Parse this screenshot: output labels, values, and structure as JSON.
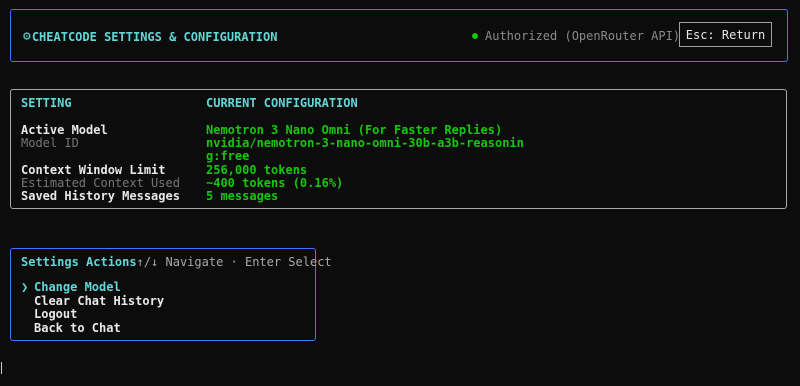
{
  "header": {
    "gear_icon": "⚙",
    "title": "CHEATCODE SETTINGS & CONFIGURATION",
    "status_text": "Authorized (OpenRouter API)",
    "status_color": "#16c60c",
    "esc_label": "Esc: Return"
  },
  "config": {
    "col_setting": "SETTING",
    "col_current": "CURRENT CONFIGURATION",
    "rows": [
      {
        "key": "Active Model",
        "value": "Nemotron 3 Nano Omni (For Faster Replies)"
      },
      {
        "key": "Model ID",
        "value": "nvidia/nemotron-3-nano-omni-30b-a3b-reasonin"
      },
      {
        "key": "",
        "value": "g:free"
      },
      {
        "key": "Context Window Limit",
        "value": "256,000 tokens"
      },
      {
        "key": "Estimated Context Used",
        "value": "~400 tokens (0.16%)"
      },
      {
        "key": "Saved History Messages",
        "value": "5 messages"
      }
    ]
  },
  "actions": {
    "title": "Settings Actions",
    "hint": "↑/↓ Navigate · Enter Select",
    "pointer": "❯",
    "items": [
      {
        "label": "Change Model"
      },
      {
        "label": "Clear Chat History"
      },
      {
        "label": "Logout"
      },
      {
        "label": "Back to Chat"
      }
    ]
  },
  "colors": {
    "accent_cyan": "#61d6d6",
    "accent_green": "#16c60c",
    "border_blue": "#3b78ff"
  }
}
